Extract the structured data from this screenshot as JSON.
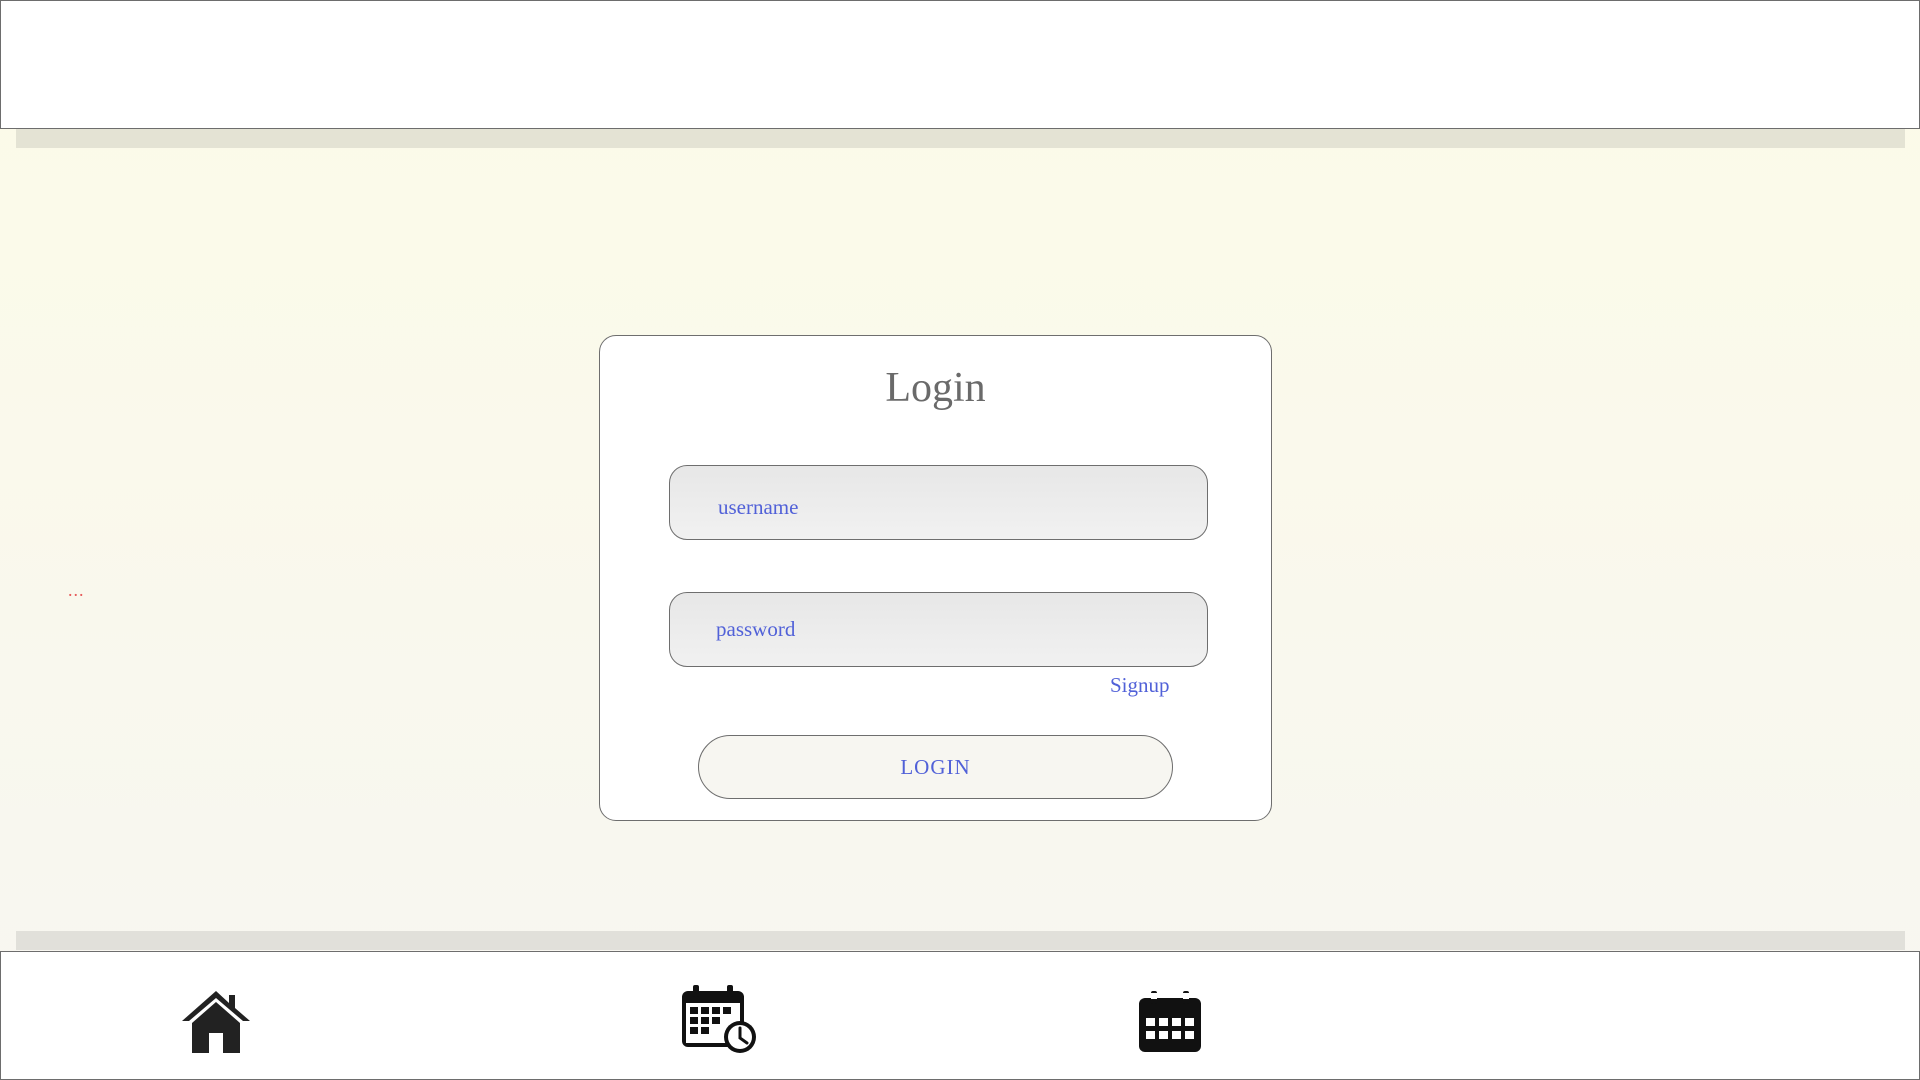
{
  "header": {},
  "side_indicator": "...",
  "login": {
    "title": "Login",
    "username_placeholder": "username",
    "password_placeholder": "password",
    "signup_label": "Signup",
    "login_button_label": "LOGIN"
  },
  "bottom_nav": {
    "items": [
      {
        "icon": "home-icon"
      },
      {
        "icon": "calendar-clock-icon"
      },
      {
        "icon": "calendar-icon"
      }
    ]
  },
  "colors": {
    "accent_text": "#5161d8",
    "title_text": "#6a6a6a",
    "ellipsis": "#e65a5a",
    "background_top": "#fcfbe8",
    "background_bottom": "#f7f6f1"
  }
}
